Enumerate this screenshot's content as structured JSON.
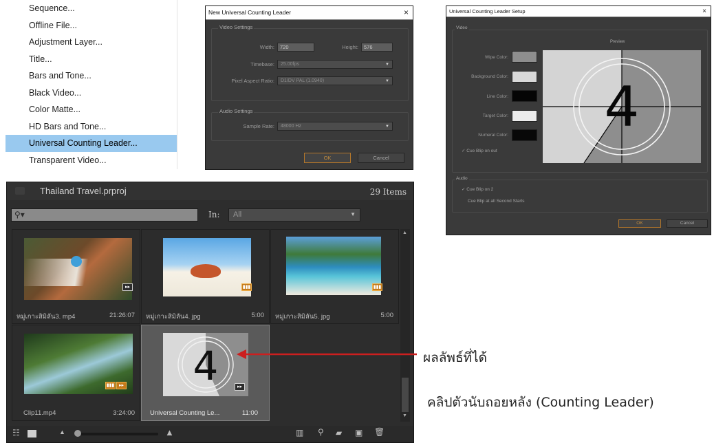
{
  "menu": {
    "items": [
      "Sequence...",
      "Offline File...",
      "Adjustment Layer...",
      "Title...",
      "Bars and Tone...",
      "Black Video...",
      "Color Matte...",
      "HD Bars and Tone...",
      "Universal Counting Leader...",
      "Transparent Video..."
    ],
    "selected_index": 8
  },
  "new_leader_dialog": {
    "title": "New Universal Counting Leader",
    "close": "×",
    "video_group": "Video Settings",
    "width_label": "Width:",
    "width_value": "720",
    "height_label": "Height:",
    "height_value": "576",
    "timebase_label": "Timebase:",
    "timebase_value": "25.00fps",
    "par_label": "Pixel Aspect Ratio:",
    "par_value": "D1/DV PAL (1.0940)",
    "audio_group": "Audio Settings",
    "sample_rate_label": "Sample Rate:",
    "sample_rate_value": "48000 Hz",
    "ok": "OK",
    "cancel": "Cancel"
  },
  "setup_dialog": {
    "title": "Universal Counting Leader Setup",
    "close": "×",
    "video_group": "Video",
    "preview_label": "Preview",
    "wipe_color_label": "Wipe Color:",
    "background_color_label": "Background Color:",
    "line_color_label": "Line Color:",
    "target_color_label": "Target Color:",
    "numeral_color_label": "Numeral Color:",
    "cue_blip_out": "Cue Blip on out",
    "cue_blip_out_checked": true,
    "audio_group": "Audio",
    "cue_blip_2": "Cue Blip on 2",
    "cue_blip_2_checked": true,
    "cue_blip_all": "Cue Blip at all Second Starts",
    "cue_blip_all_checked": false,
    "preview_numeral": "4",
    "ok": "OK",
    "cancel": "Cancel",
    "colors": {
      "wipe": "#8e8e8e",
      "background": "#d9d9d9",
      "line": "#050505",
      "target": "#ececec",
      "numeral": "#080808"
    }
  },
  "project_panel": {
    "title": "Thailand Travel.prproj",
    "item_count": "29 Items",
    "search_glyph": "⚲▾",
    "in_label": "In:",
    "in_value": "All",
    "items": [
      {
        "name": "หมู่เกาะสิมิลัน3. mp4",
        "duration": "21:26:07",
        "kind": "video"
      },
      {
        "name": "หมู่เกาะสิมิลัน4. jpg",
        "duration": "5:00",
        "kind": "still"
      },
      {
        "name": "หมู่เกาะสิมิลัน5. jpg",
        "duration": "5:00",
        "kind": "still"
      },
      {
        "name": "Clip11.mp4",
        "duration": "3:24:00",
        "kind": "video"
      },
      {
        "name": "Universal Counting Le...",
        "duration": "11:00",
        "kind": "leader",
        "numeral": "4"
      }
    ],
    "icons": [
      "list-view",
      "icon-view",
      "zoom-out",
      "zoom-slider",
      "zoom-in",
      "automate-to-sequence",
      "find",
      "new-bin",
      "new-item",
      "clear"
    ]
  },
  "annotation": {
    "result_label": "ผลลัพธ์ที่ได้",
    "description": "คลิปตัวนับถอยหลัง (Counting Leader)",
    "arrow_color": "#cc1f1f"
  }
}
